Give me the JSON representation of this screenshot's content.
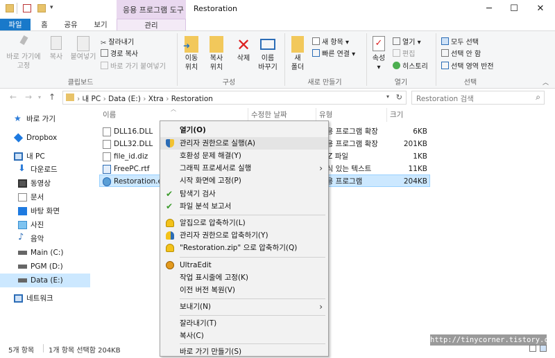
{
  "window": {
    "title": "Restoration",
    "context_tab_group": "응용 프로그램 도구",
    "controls": [
      "─",
      "☐",
      "✕"
    ]
  },
  "ribbon_tabs": [
    "파일",
    "홈",
    "공유",
    "보기",
    "관리"
  ],
  "ribbon": {
    "clipboard": {
      "pin_quick": "바로 가기에\n고정",
      "copy": "복사",
      "paste": "붙여넣기",
      "cut": "잘라내기",
      "copy_path": "경로 복사",
      "paste_shortcut": "바로 가기 붙여넣기",
      "group": "클립보드"
    },
    "organize": {
      "move_to": "이동\n위치",
      "copy_to": "복사\n위치",
      "delete": "삭제",
      "rename": "이름\n바꾸기",
      "group": "구성"
    },
    "new": {
      "new_folder": "새\n폴더",
      "new_item": "새 항목",
      "easy_access": "빠른 연결",
      "group": "새로 만들기"
    },
    "open": {
      "properties": "속성",
      "open": "열기",
      "edit": "편집",
      "history": "히스토리",
      "group": "열기"
    },
    "select": {
      "select_all": "모두 선택",
      "select_none": "선택 안 함",
      "invert": "선택 영역 반전",
      "group": "선택"
    }
  },
  "address": {
    "breadcrumb": [
      "내 PC",
      "Data (E:)",
      "Xtra",
      "Restoration"
    ],
    "search_placeholder": "Restoration 검색"
  },
  "sidebar": [
    {
      "label": "바로 가기",
      "icon": "star-icon"
    },
    {
      "label": "Dropbox",
      "icon": "dropbox-icon"
    },
    {
      "label": "내 PC",
      "icon": "pc-icon"
    },
    {
      "label": "다운로드",
      "icon": "download-icon"
    },
    {
      "label": "동영상",
      "icon": "video-icon"
    },
    {
      "label": "문서",
      "icon": "document-icon"
    },
    {
      "label": "바탕 화면",
      "icon": "desktop-icon"
    },
    {
      "label": "사진",
      "icon": "picture-icon"
    },
    {
      "label": "음악",
      "icon": "music-icon"
    },
    {
      "label": "Main (C:)",
      "icon": "drive-icon"
    },
    {
      "label": "PGM (D:)",
      "icon": "drive-icon"
    },
    {
      "label": "Data (E:)",
      "icon": "drive-icon"
    },
    {
      "label": "네트워크",
      "icon": "network-icon"
    }
  ],
  "columns": [
    "이름",
    "수정한 날짜",
    "유형",
    "크기"
  ],
  "files": [
    {
      "name": "DLL16.DLL",
      "type": "응용 프로그램 확장",
      "size": "6KB"
    },
    {
      "name": "DLL32.DLL",
      "type": "응용 프로그램 확장",
      "size": "201KB"
    },
    {
      "name": "file_id.diz",
      "type": "DIZ 파일",
      "size": "1KB"
    },
    {
      "name": "FreePC.rtf",
      "type": "서식 있는 텍스트",
      "size": "11KB"
    },
    {
      "name": "Restoration.exe",
      "type": "응용 프로그램",
      "size": "204KB"
    }
  ],
  "status": {
    "count": "5개 항목",
    "selected": "1개 항목 선택함 204KB"
  },
  "context_menu": [
    "열기(O)",
    "관리자 권한으로 실행(A)",
    "호환성 문제 해결(Y)",
    "그래픽 프로세서로 실행",
    "시작 화면에 고정(P)",
    "탐색기 검사",
    "파일 분석 보고서",
    "알집으로 압축하기(L)",
    "관리자 권한으로 압축하기(Y)",
    "\"Restoration.zip\" 으로 압축하기(Q)",
    "UltraEdit",
    "작업 표시줄에 고정(K)",
    "이전 버전 복원(V)",
    "보내기(N)",
    "잘라내기(T)",
    "복사(C)",
    "바로 가기 만들기(S)"
  ],
  "watermark": "http://tinycorner.tistory.com",
  "colors": {
    "accent": "#1979ca",
    "selection": "#cce8ff",
    "context_tab": "#e9d8ef"
  }
}
